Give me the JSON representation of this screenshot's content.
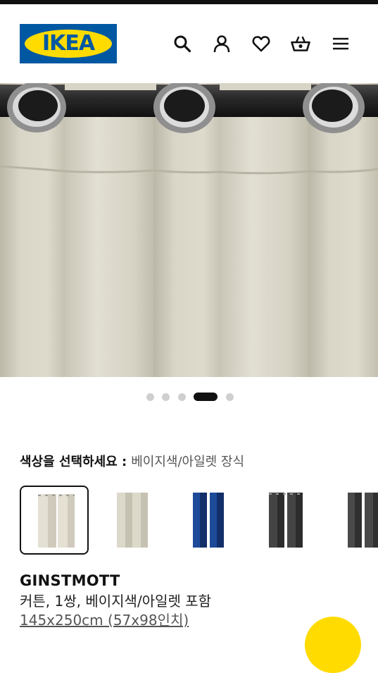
{
  "brand": {
    "logo_text": "IKEA",
    "colors": {
      "blue": "#0058a3",
      "yellow": "#ffdb00"
    }
  },
  "header": {
    "icons": [
      "search-icon",
      "account-icon",
      "heart-icon",
      "basket-icon",
      "menu-icon"
    ]
  },
  "gallery": {
    "image_count": 5,
    "active_index": 3
  },
  "color_select": {
    "label": "색상을 선택하세요 :",
    "selected_value": "베이지색/아일렛 장식",
    "options": [
      {
        "name": "beige-eyelet",
        "color": "#d8d2c2",
        "selected": true
      },
      {
        "name": "beige",
        "color": "#d5d2c3",
        "selected": false
      },
      {
        "name": "blue",
        "color": "#1d3f8a",
        "selected": false
      },
      {
        "name": "dark-gray-eyelet",
        "color": "#3a3a3a",
        "selected": false
      },
      {
        "name": "dark-gray",
        "color": "#444444",
        "selected": false
      }
    ]
  },
  "product": {
    "name": "GINSTMOTT",
    "description": "커튼, 1쌍, 베이지색/아일렛 포함",
    "size": "145x250cm (57x98인치)"
  }
}
